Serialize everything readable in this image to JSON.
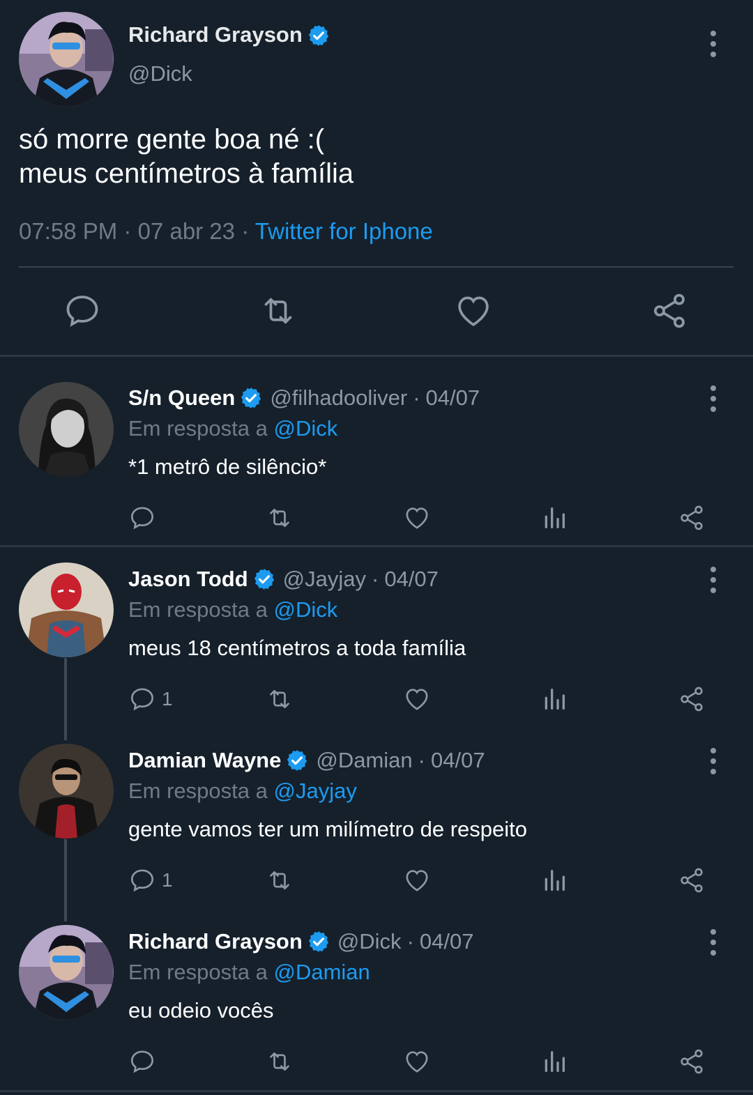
{
  "colors": {
    "background": "#15202b",
    "text": "#e7e9ea",
    "muted": "#8b98a5",
    "link": "#1d9bf0",
    "verified": "#1d9bf0",
    "divider": "#38444d"
  },
  "main_tweet": {
    "author_name": "Richard Grayson",
    "handle": "@Dick",
    "verified": true,
    "text": "só morre gente boa né :(\nmeus centímetros à família",
    "time": "07:58 PM",
    "separator": "·",
    "date": "07 abr 23",
    "source": "Twitter for Iphone",
    "avatar_icon": "nightwing-avatar",
    "actions": [
      {
        "icon": "reply-icon"
      },
      {
        "icon": "retweet-icon"
      },
      {
        "icon": "like-icon"
      },
      {
        "icon": "share-icon"
      }
    ]
  },
  "replies": [
    {
      "author_name": "S/n Queen",
      "handle": "@filhadooliver",
      "date_sep": "·",
      "date": "04/07",
      "verified": true,
      "reply_prefix": "Em resposta a",
      "reply_to": "@Dick",
      "text": "*1 metrô de silêncio*",
      "reply_count": "",
      "avatar_icon": "dark-haired-girl-avatar"
    },
    {
      "author_name": "Jason Todd",
      "handle": "@Jayjay",
      "date_sep": "·",
      "date": "04/07",
      "verified": true,
      "reply_prefix": "Em resposta a",
      "reply_to": "@Dick",
      "text": "meus 18 centímetros a toda família",
      "reply_count": "1",
      "avatar_icon": "red-hood-avatar"
    },
    {
      "author_name": "Damian Wayne",
      "handle": "@Damian",
      "date_sep": "·",
      "date": "04/07",
      "verified": true,
      "reply_prefix": "Em resposta a",
      "reply_to": "@Jayjay",
      "text": "gente vamos ter um milímetro de respeito",
      "reply_count": "1",
      "avatar_icon": "robin-avatar"
    },
    {
      "author_name": "Richard Grayson",
      "handle": "@Dick",
      "date_sep": "·",
      "date": "04/07",
      "verified": true,
      "reply_prefix": "Em resposta a",
      "reply_to": "@Damian",
      "text": "eu odeio vocês",
      "reply_count": "",
      "avatar_icon": "nightwing-avatar"
    }
  ]
}
